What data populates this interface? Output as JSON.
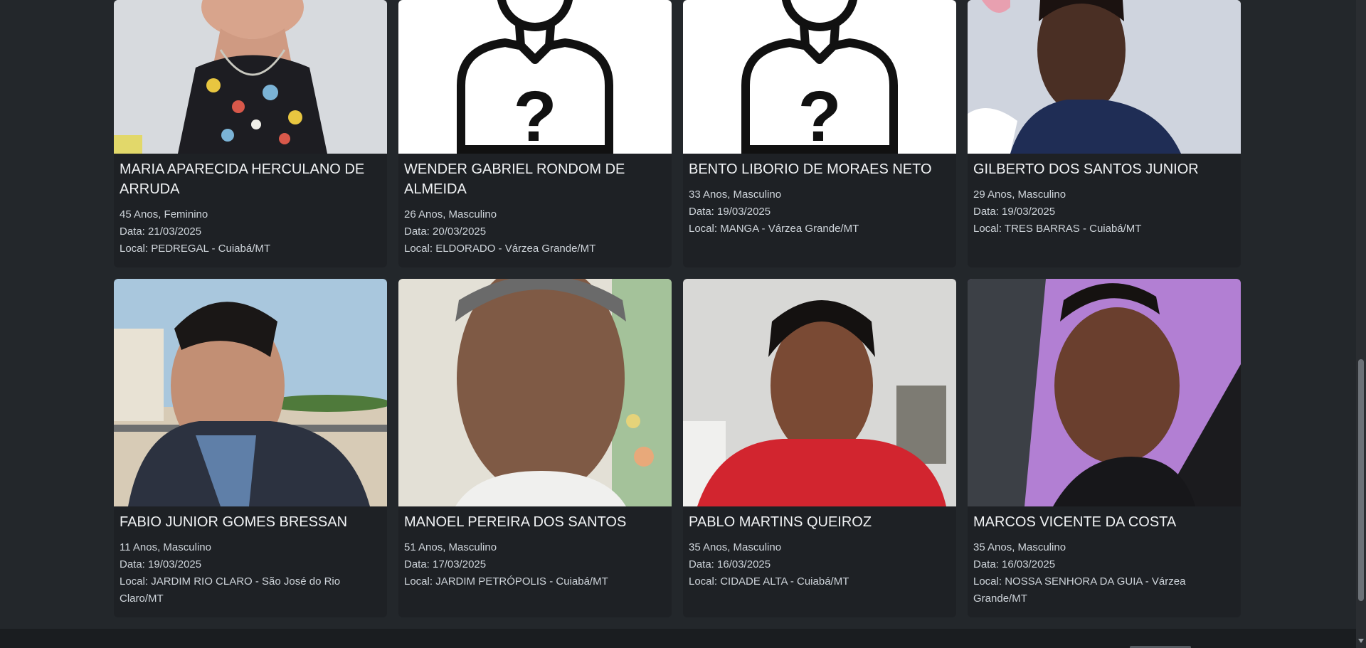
{
  "cards": [
    {
      "name": "MARIA APARECIDA HERCULANO DE ARRUDA",
      "age_sex": "45 Anos, Feminino",
      "date": "Data: 21/03/2025",
      "local": "Local: PEDREGAL - Cuiabá/MT",
      "photo": "woman-photo"
    },
    {
      "name": "WENDER GABRIEL RONDOM DE ALMEIDA",
      "age_sex": "26 Anos, Masculino",
      "date": "Data: 20/03/2025",
      "local": "Local: ELDORADO - Várzea Grande/MT",
      "photo": "unknown-person-icon"
    },
    {
      "name": "BENTO LIBORIO DE MORAES NETO",
      "age_sex": "33 Anos, Masculino",
      "date": "Data: 19/03/2025",
      "local": "Local: MANGA - Várzea Grande/MT",
      "photo": "unknown-person-icon"
    },
    {
      "name": "GILBERTO DOS SANTOS JUNIOR",
      "age_sex": "29 Anos, Masculino",
      "date": "Data: 19/03/2025",
      "local": "Local: TRES BARRAS - Cuiabá/MT",
      "photo": "man-photo"
    },
    {
      "name": "FABIO JUNIOR GOMES BRESSAN",
      "age_sex": "11 Anos, Masculino",
      "date": "Data: 19/03/2025",
      "local": "Local: JARDIM RIO CLARO - São José do Rio Claro/MT",
      "photo": "boy-photo"
    },
    {
      "name": "MANOEL PEREIRA DOS SANTOS",
      "age_sex": "51 Anos, Masculino",
      "date": "Data: 17/03/2025",
      "local": "Local: JARDIM PETRÓPOLIS - Cuiabá/MT",
      "photo": "man-photo"
    },
    {
      "name": "PABLO MARTINS QUEIROZ",
      "age_sex": "35 Anos, Masculino",
      "date": "Data: 16/03/2025",
      "local": "Local: CIDADE ALTA - Cuiabá/MT",
      "photo": "man-photo"
    },
    {
      "name": "MARCOS VICENTE DA COSTA",
      "age_sex": "35 Anos, Masculino",
      "date": "Data: 16/03/2025",
      "local": "Local: NOSSA SENHORA DA GUIA - Várzea Grande/MT",
      "photo": "man-photo"
    }
  ],
  "colors": {
    "page_bg": "#23272b",
    "card_bg": "#1e2125",
    "text": "#dee2e6"
  }
}
